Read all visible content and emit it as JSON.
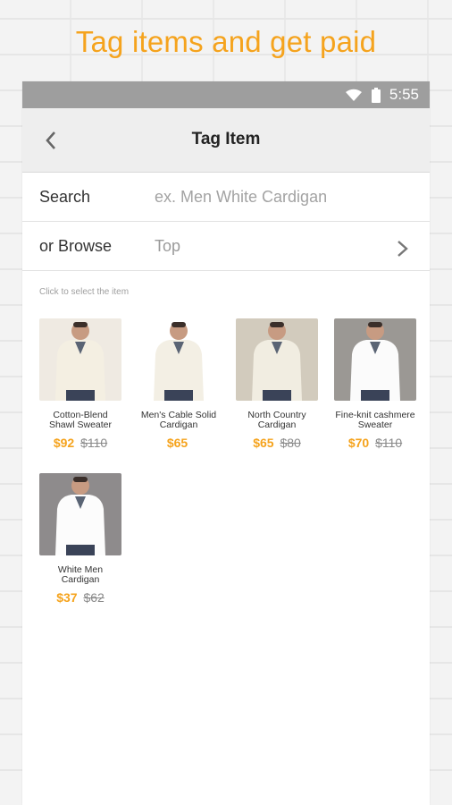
{
  "promo": {
    "headline": "Tag items and get paid"
  },
  "status_bar": {
    "time": "5:55",
    "icons": [
      "wifi-icon",
      "battery-icon"
    ]
  },
  "app_bar": {
    "title": "Tag Item",
    "back_icon": "chevron-left-icon"
  },
  "search": {
    "label": "Search",
    "placeholder": "ex. Men White Cardigan",
    "value": ""
  },
  "browse": {
    "label": "or Browse",
    "value": "Top",
    "chevron_icon": "chevron-right-icon"
  },
  "hint": "Click to select the item",
  "items": [
    {
      "name": "Cotton-Blend Shawl Sweater",
      "price": "$92",
      "original_price": "$110",
      "bg": "#efeae2",
      "garment": "#f4efe2"
    },
    {
      "name": "Men's Cable Solid Cardigan",
      "price": "$65",
      "original_price": "",
      "bg": "#ffffff",
      "garment": "#f3efe4"
    },
    {
      "name": "North Country Cardigan",
      "price": "$65",
      "original_price": "$80",
      "bg": "#d2cbbd",
      "garment": "#f1ede1"
    },
    {
      "name": "Fine-knit cashmere Sweater",
      "price": "$70",
      "original_price": "$110",
      "bg": "#9b9894",
      "garment": "#fbfbfb"
    },
    {
      "name": "White Men Cardigan",
      "price": "$37",
      "original_price": "$62",
      "bg": "#8e8b8c",
      "garment": "#fcfcfc"
    }
  ],
  "colors": {
    "accent": "#f5a31d",
    "status_bar": "#9e9e9e",
    "app_bar": "#eeeeee"
  }
}
